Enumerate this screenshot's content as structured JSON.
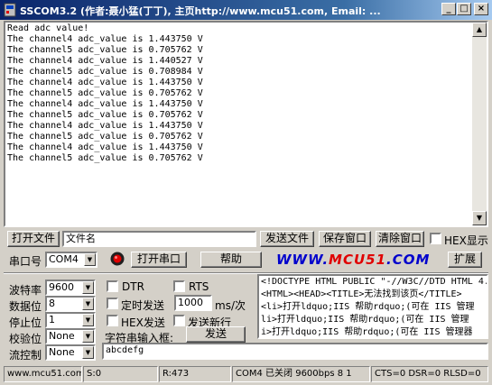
{
  "window": {
    "title": "SSCOM3.2 (作者:聂小猛(丁丁), 主页http://www.mcu51.com,  Email: ...",
    "minimize": "_",
    "maximize": "□",
    "close": "×"
  },
  "receive": {
    "lines": [
      "Read adc value!",
      "The channel4 adc_value is 1.443750 V",
      "The channel5 adc_value is 0.705762 V",
      "The channel4 adc_value is 1.440527 V",
      "The channel5 adc_value is 0.708984 V",
      "The channel4 adc_value is 1.443750 V",
      "The channel5 adc_value is 0.705762 V",
      "The channel4 adc_value is 1.443750 V",
      "The channel5 adc_value is 0.705762 V",
      "The channel4 adc_value is 1.443750 V",
      "The channel5 adc_value is 0.705762 V",
      "The channel4 adc_value is 1.443750 V",
      "The channel5 adc_value is 0.705762 V"
    ]
  },
  "toolbar1": {
    "open_file": "打开文件",
    "file_name": "文件名",
    "send_file": "发送文件",
    "save_window": "保存窗口",
    "clear_window": "清除窗口",
    "hex_display": "HEX显示"
  },
  "toolbar2": {
    "port_label": "串口号",
    "port_value": "COM4",
    "open_port": "打开串口",
    "help": "帮助",
    "logo_a": "WWW.",
    "logo_b": "MCU51",
    "logo_c": ".COM",
    "expand": "扩展"
  },
  "settings": {
    "baud_label": "波特率",
    "baud_value": "9600",
    "databits_label": "数据位",
    "databits_value": "8",
    "stopbits_label": "停止位",
    "stopbits_value": "1",
    "parity_label": "校验位",
    "parity_value": "None",
    "flow_label": "流控制",
    "flow_value": "None"
  },
  "options": {
    "dtr": "DTR",
    "rts": "RTS",
    "timed_send": "定时发送",
    "interval_value": "1000",
    "interval_unit": "ms/次",
    "hex_send": "HEX发送",
    "send_newline": "发送新行",
    "input_label": "字符串输入框:",
    "send": "发送"
  },
  "html_area": {
    "lines": [
      "<!DOCTYPE HTML PUBLIC \"-//W3C//DTD HTML 4.",
      "<HTML><HEAD><TITLE>无法找到该页</TITLE>",
      "<li>打开ldquo;IIS 帮助rdquo;(可在 IIS 管理",
      "li>打开ldquo;IIS 帮助rdquo;(可在 IIS 管理",
      "i>打开ldquo;IIS 帮助rdquo;(可在 IIS 管理器"
    ]
  },
  "send_input": {
    "value": "abcdefg"
  },
  "statusbar": {
    "site": "www.mcu51.com",
    "sent": "S:0",
    "received": "R:473",
    "port_state": "COM4 已关闭  9600bps  8  1",
    "lines": "CTS=0 DSR=0 RLSD=0"
  }
}
